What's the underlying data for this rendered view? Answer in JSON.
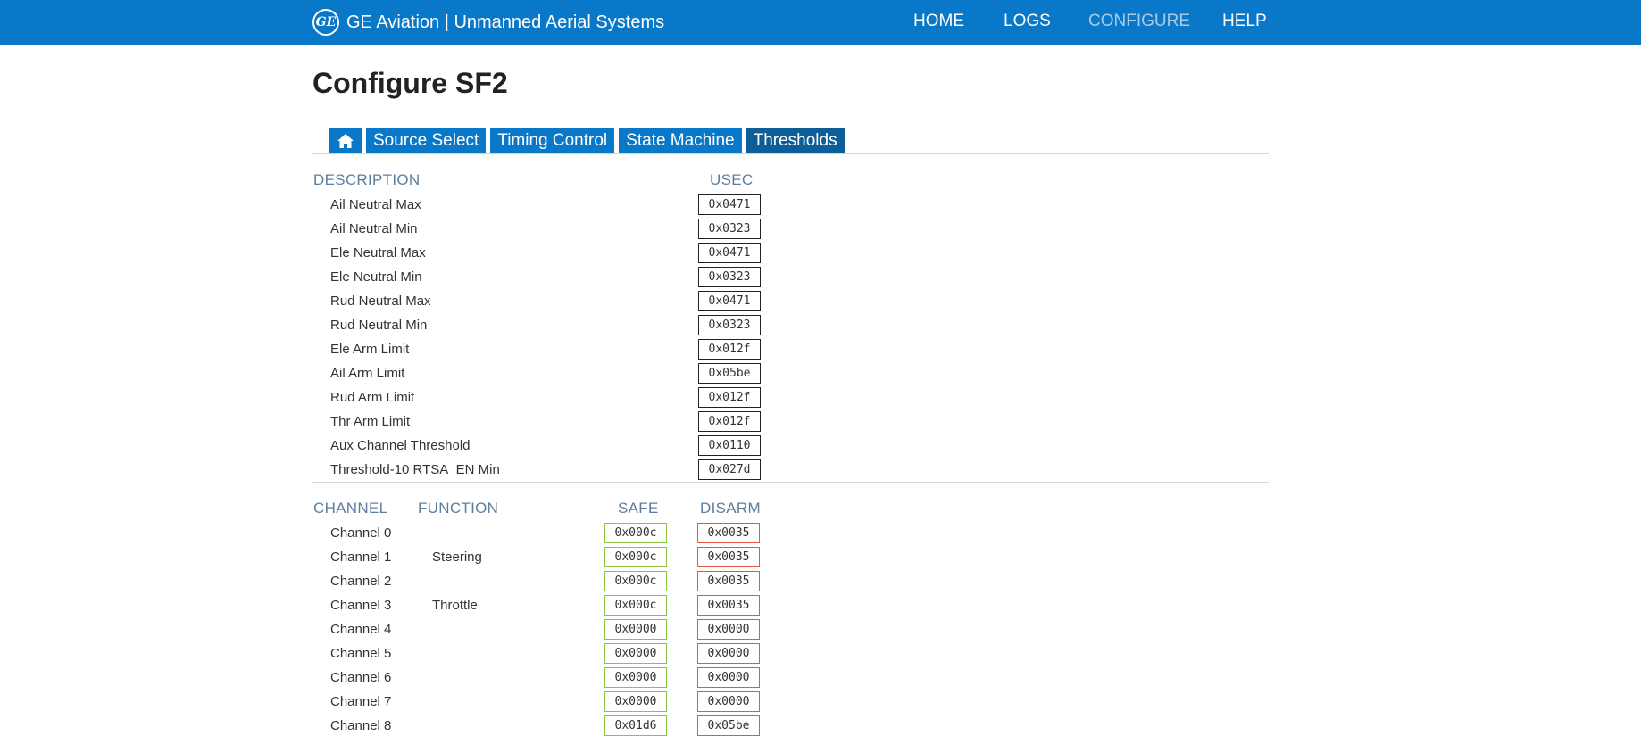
{
  "brand": {
    "logo_text": "GE",
    "title": "GE Aviation | Unmanned Aerial Systems"
  },
  "nav": [
    {
      "label": "HOME",
      "active": false
    },
    {
      "label": "LOGS",
      "active": false
    },
    {
      "label": "CONFIGURE",
      "active": true
    },
    {
      "label": "HELP",
      "active": false
    }
  ],
  "page_title": "Configure SF2",
  "tabs": [
    {
      "label": "",
      "icon": "home-icon",
      "active": false
    },
    {
      "label": "Source Select",
      "active": false
    },
    {
      "label": "Timing Control",
      "active": false
    },
    {
      "label": "State Machine",
      "active": false
    },
    {
      "label": "Thresholds",
      "active": true
    }
  ],
  "thresholds": {
    "col_description": "DESCRIPTION",
    "col_usec": "USEC",
    "rows": [
      {
        "label": "Ail Neutral Max",
        "value": "0x0471"
      },
      {
        "label": "Ail Neutral Min",
        "value": "0x0323"
      },
      {
        "label": "Ele Neutral Max",
        "value": "0x0471"
      },
      {
        "label": "Ele Neutral Min",
        "value": "0x0323"
      },
      {
        "label": "Rud Neutral Max",
        "value": "0x0471"
      },
      {
        "label": "Rud Neutral Min",
        "value": "0x0323"
      },
      {
        "label": "Ele Arm Limit",
        "value": "0x012f"
      },
      {
        "label": "Ail Arm Limit",
        "value": "0x05be"
      },
      {
        "label": "Rud Arm Limit",
        "value": "0x012f"
      },
      {
        "label": "Thr Arm Limit",
        "value": "0x012f"
      },
      {
        "label": "Aux Channel Threshold",
        "value": "0x0110"
      },
      {
        "label": "Threshold-10 RTSA_EN Min",
        "value": "0x027d"
      }
    ]
  },
  "channels": {
    "col_channel": "CHANNEL",
    "col_function": "FUNCTION",
    "col_safe": "SAFE",
    "col_disarm": "DISARM",
    "rows": [
      {
        "label": "Channel 0",
        "function": "",
        "safe": "0x000c",
        "disarm": "0x0035"
      },
      {
        "label": "Channel 1",
        "function": "Steering",
        "safe": "0x000c",
        "disarm": "0x0035"
      },
      {
        "label": "Channel 2",
        "function": "",
        "safe": "0x000c",
        "disarm": "0x0035"
      },
      {
        "label": "Channel 3",
        "function": "Throttle",
        "safe": "0x000c",
        "disarm": "0x0035"
      },
      {
        "label": "Channel 4",
        "function": "",
        "safe": "0x0000",
        "disarm": "0x0000"
      },
      {
        "label": "Channel 5",
        "function": "",
        "safe": "0x0000",
        "disarm": "0x0000"
      },
      {
        "label": "Channel 6",
        "function": "",
        "safe": "0x0000",
        "disarm": "0x0000"
      },
      {
        "label": "Channel 7",
        "function": "",
        "safe": "0x0000",
        "disarm": "0x0000"
      },
      {
        "label": "Channel 8",
        "function": "",
        "safe": "0x01d6",
        "disarm": "0x05be"
      }
    ]
  },
  "colors": {
    "primary": "#0a78c9",
    "active_tab": "#0c5e98",
    "safe": "#8cc63f",
    "disarm": "#e8544b",
    "header_text": "#5d7d9d"
  }
}
